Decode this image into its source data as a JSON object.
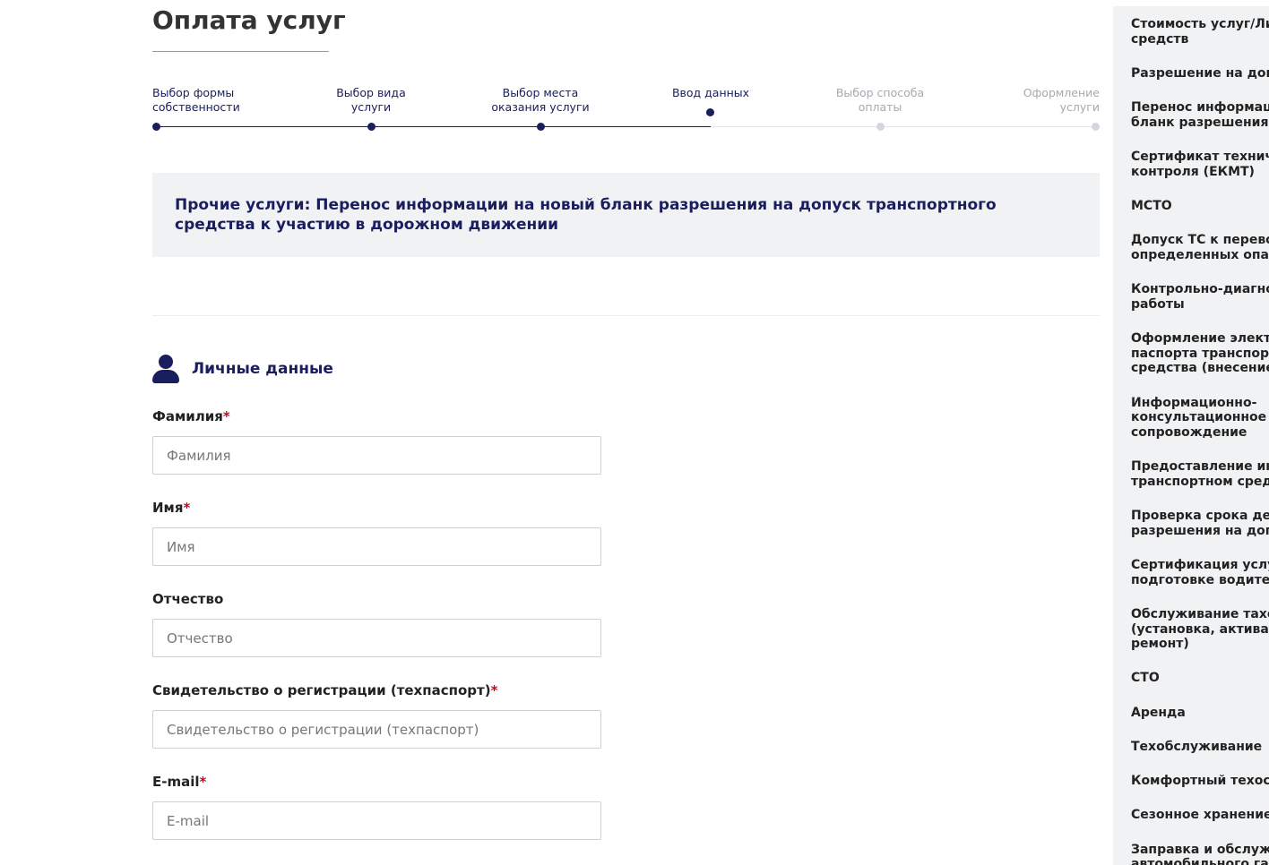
{
  "page": {
    "title": "Оплата услуг"
  },
  "stepper": {
    "steps": [
      {
        "label": "Выбор формы\nсобственности",
        "state": "done"
      },
      {
        "label": "Выбор вида\nуслуги",
        "state": "done"
      },
      {
        "label": "Выбор места\nоказания услуги",
        "state": "done"
      },
      {
        "label": "Ввод данных",
        "state": "current"
      },
      {
        "label": "Выбор способа\nоплаты",
        "state": "future"
      },
      {
        "label": "Оформление\nуслуги",
        "state": "future"
      }
    ]
  },
  "banner": {
    "text": "Прочие услуги: Перенос информации на новый бланк разрешения на допуск транспортного средства к участию в дорожном движении"
  },
  "personal": {
    "title": "Личные данные",
    "icon": "person-icon",
    "fields": [
      {
        "label": "Фамилия",
        "required": "*",
        "placeholder": "Фамилия",
        "value": ""
      },
      {
        "label": "Имя",
        "required": "*",
        "placeholder": "Имя",
        "value": ""
      },
      {
        "label": "Отчество",
        "required": "",
        "placeholder": "Отчество",
        "value": ""
      },
      {
        "label": "Свидетельство о регистрации (техпаспорт)",
        "required": "*",
        "placeholder": "Свидетельство о регистрации (техпаспорт)",
        "value": ""
      },
      {
        "label": "E-mail",
        "required": "*",
        "placeholder": "E-mail",
        "value": ""
      }
    ]
  },
  "sidebar": {
    "items": [
      "Стоимость услуг/Ли\nсредств",
      "Разрешение на доп",
      "Перенос информаци\nбланк разрешения",
      "Сертификат техниче\nконтроля (ЕКМТ)",
      "МСТО",
      "Допуск ТС к перевоз\nопределенных опас",
      "Контрольно-диагнос\nработы",
      "Оформление электр\nпаспорта транспорт\nсредства (внесение",
      "Информационно-\nконсультационное\nсопровождение",
      "Предоставление инф\nтранспортном сред",
      "Проверка срока дей\nразрешения на доп",
      "Сертификация услуг\nподготовке водител",
      "Обслуживание тахо\n(установка, активац\nремонт)",
      "СТО",
      "Аренда",
      "Техобслуживание",
      "Комфортный техоск",
      "Сезонное хранение",
      "Заправка и обслужи\nавтомобильного газ"
    ]
  },
  "colors": {
    "primary": "#1a1d5e",
    "required": "#d0021b",
    "panel": "#f1f2f4"
  }
}
